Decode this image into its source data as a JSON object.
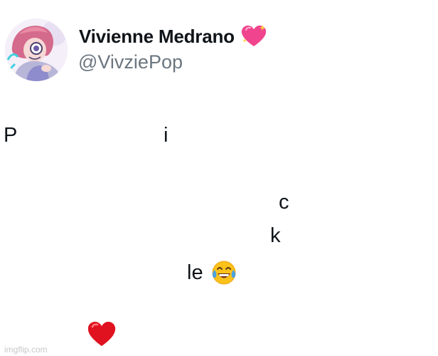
{
  "tweet": {
    "author": {
      "display_name": "Vivienne Medrano",
      "handle": "@VivziePop",
      "name_badge_icon": "sparkling-heart-icon"
    },
    "body_fragments": [
      "P",
      "i",
      "c",
      "k",
      "le"
    ],
    "emojis": [
      "face-with-tears-of-joy-icon",
      "red-heart-icon"
    ]
  },
  "watermark": "imgflip.com",
  "colors": {
    "text": "#0f1419",
    "handle": "#6b7680",
    "heart_pink": "#f0448e",
    "heart_red": "#e0121f",
    "emoji_yellow": "#fcc21b",
    "tears_blue": "#4aa3e0"
  }
}
